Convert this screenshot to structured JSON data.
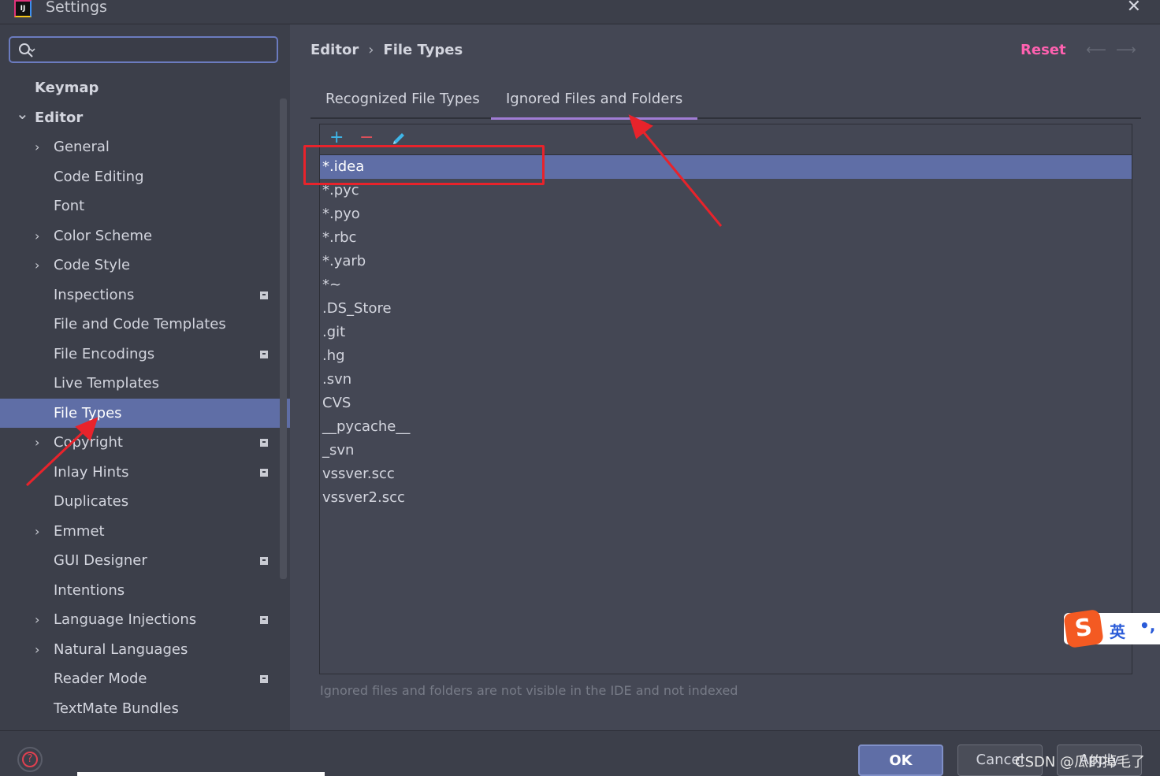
{
  "window": {
    "title": "Settings",
    "logo_text": "IJ"
  },
  "search": {
    "placeholder": ""
  },
  "sidebar": {
    "items": [
      {
        "label": "Keymap",
        "level": 0,
        "expandable": false,
        "project_badge": false
      },
      {
        "label": "Editor",
        "level": 0,
        "expandable": true,
        "expanded": true,
        "project_badge": false
      },
      {
        "label": "General",
        "level": 1,
        "expandable": true,
        "project_badge": false
      },
      {
        "label": "Code Editing",
        "level": 1,
        "expandable": false,
        "project_badge": false
      },
      {
        "label": "Font",
        "level": 1,
        "expandable": false,
        "project_badge": false
      },
      {
        "label": "Color Scheme",
        "level": 1,
        "expandable": true,
        "project_badge": false
      },
      {
        "label": "Code Style",
        "level": 1,
        "expandable": true,
        "project_badge": false
      },
      {
        "label": "Inspections",
        "level": 1,
        "expandable": false,
        "project_badge": true
      },
      {
        "label": "File and Code Templates",
        "level": 1,
        "expandable": false,
        "project_badge": false
      },
      {
        "label": "File Encodings",
        "level": 1,
        "expandable": false,
        "project_badge": true
      },
      {
        "label": "Live Templates",
        "level": 1,
        "expandable": false,
        "project_badge": false
      },
      {
        "label": "File Types",
        "level": 1,
        "expandable": false,
        "project_badge": false,
        "selected": true
      },
      {
        "label": "Copyright",
        "level": 1,
        "expandable": true,
        "project_badge": true
      },
      {
        "label": "Inlay Hints",
        "level": 1,
        "expandable": false,
        "project_badge": true
      },
      {
        "label": "Duplicates",
        "level": 1,
        "expandable": false,
        "project_badge": false
      },
      {
        "label": "Emmet",
        "level": 1,
        "expandable": true,
        "project_badge": false
      },
      {
        "label": "GUI Designer",
        "level": 1,
        "expandable": false,
        "project_badge": true
      },
      {
        "label": "Intentions",
        "level": 1,
        "expandable": false,
        "project_badge": false
      },
      {
        "label": "Language Injections",
        "level": 1,
        "expandable": true,
        "project_badge": true
      },
      {
        "label": "Natural Languages",
        "level": 1,
        "expandable": true,
        "project_badge": false
      },
      {
        "label": "Reader Mode",
        "level": 1,
        "expandable": false,
        "project_badge": true
      },
      {
        "label": "TextMate Bundles",
        "level": 1,
        "expandable": false,
        "project_badge": false
      }
    ]
  },
  "breadcrumb": {
    "parent": "Editor",
    "current": "File Types",
    "separator": "›"
  },
  "header": {
    "reset_label": "Reset",
    "back_glyph": "🡐",
    "forward_glyph": "🡒"
  },
  "tabs": [
    {
      "label": "Recognized File Types",
      "active": false
    },
    {
      "label": "Ignored Files and Folders",
      "active": true
    }
  ],
  "toolbar": {
    "add_glyph": "+",
    "remove_glyph": "−"
  },
  "ignored": {
    "items": [
      "*.idea",
      "*.pyc",
      "*.pyo",
      "*.rbc",
      "*.yarb",
      "*~",
      ".DS_Store",
      ".git",
      ".hg",
      ".svn",
      "CVS",
      "__pycache__",
      "_svn",
      "vssver.scc",
      "vssver2.scc"
    ],
    "selected_index": 0,
    "hint": "Ignored files and folders are not visible in the IDE and not indexed"
  },
  "footer": {
    "ok_label": "OK",
    "cancel_label": "Cancel",
    "apply_label": "Apply",
    "help_glyph": "?",
    "watermark": "CSDN @瓜的掉毛了"
  },
  "ime": {
    "logo": "S",
    "mode": "英",
    "punct": "•,"
  },
  "colors": {
    "selection": "#5f6ea6",
    "reset": "#ff61b0",
    "tab_underline": "#a07cd4",
    "annotation": "#e8232b",
    "add": "#3fb6e8",
    "remove": "#e0505a"
  }
}
